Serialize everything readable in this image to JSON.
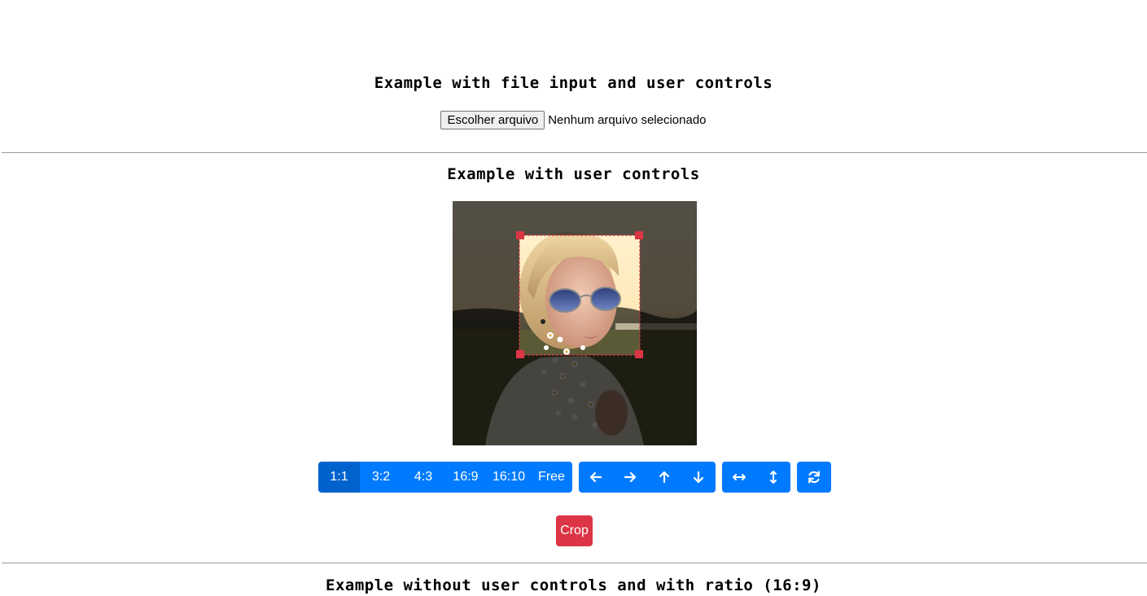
{
  "section1": {
    "title": "Example with file input and user controls",
    "file_button_label": "Escolher arquivo",
    "file_status": "Nenhum arquivo selecionado"
  },
  "section2": {
    "title": "Example with user controls",
    "aspect_ratios": [
      {
        "label": "1:1",
        "active": true
      },
      {
        "label": "3:2",
        "active": false
      },
      {
        "label": "4:3",
        "active": false
      },
      {
        "label": "16:9",
        "active": false
      },
      {
        "label": "16:10",
        "active": false
      },
      {
        "label": "Free",
        "active": false
      }
    ],
    "move_icons": [
      "arrow-left-icon",
      "arrow-right-icon",
      "arrow-up-icon",
      "arrow-down-icon"
    ],
    "flip_icons": [
      "flip-horizontal-icon",
      "flip-vertical-icon"
    ],
    "reset_icon": "refresh-icon",
    "crop_button_label": "Crop"
  },
  "section3": {
    "title": "Example without user controls and with ratio (16:9)"
  },
  "colors": {
    "primary": "#007bff",
    "primary_active": "#0062cc",
    "danger": "#dc3545",
    "divider": "#9a9a9a"
  }
}
